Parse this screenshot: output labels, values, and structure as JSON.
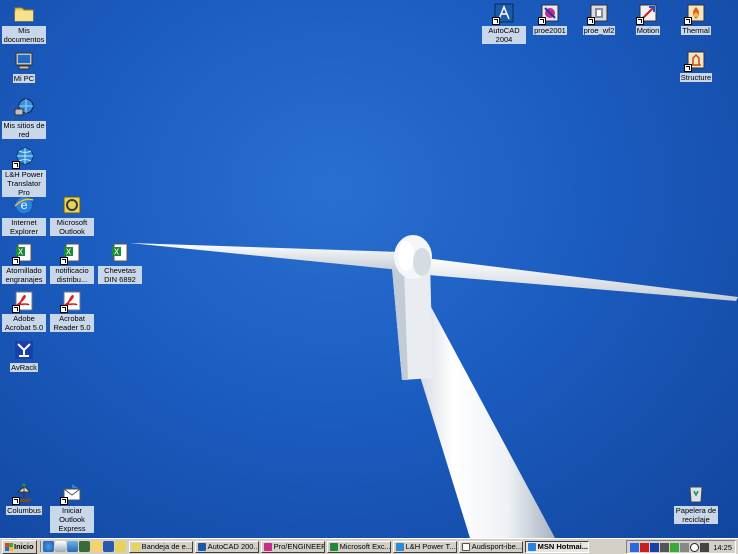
{
  "desktop": {
    "icons_left": [
      {
        "label": "Mis documentos",
        "icon": "folder-icon"
      },
      {
        "label": "Mi PC",
        "icon": "computer-icon"
      },
      {
        "label": "Mis sitios de red",
        "icon": "network-icon"
      },
      {
        "label": "L&H Power Translator Pro",
        "icon": "globe-icon"
      },
      {
        "label": "Internet Explorer",
        "icon": "internet-explorer-icon"
      },
      {
        "label": "Microsoft Outlook",
        "icon": "outlook-icon"
      },
      {
        "label": "Atornillado engranajes",
        "icon": "excel-icon"
      },
      {
        "label": "notificacio distribu...",
        "icon": "excel-icon"
      },
      {
        "label": "Chevetas DIN 6892",
        "icon": "excel-icon"
      },
      {
        "label": "Adobe Acrobat 5.0",
        "icon": "acrobat-icon"
      },
      {
        "label": "Acrobat Reader 5.0",
        "icon": "acrobat-reader-icon"
      },
      {
        "label": "AvRack",
        "icon": "avrack-icon"
      },
      {
        "label": "Columbus",
        "icon": "columbus-icon"
      },
      {
        "label": "Iniciar Outlook Express",
        "icon": "outlook-express-icon"
      }
    ],
    "icons_right": [
      {
        "label": "AutoCAD 2004",
        "icon": "autocad-icon"
      },
      {
        "label": "proe2001",
        "icon": "proe-icon"
      },
      {
        "label": "proe_wf2",
        "icon": "proe-wildfire-icon"
      },
      {
        "label": "Motion",
        "icon": "motion-icon"
      },
      {
        "label": "Thermal",
        "icon": "thermal-icon"
      },
      {
        "label": "Structure",
        "icon": "structure-icon"
      },
      {
        "label": "Papelera de reciclaje",
        "icon": "recycle-bin-icon"
      }
    ]
  },
  "taskbar": {
    "start_label": "Inicio",
    "quick_launch": [
      "internet-explorer-icon",
      "outlook-express-icon",
      "show-desktop-icon",
      "media-icon",
      "folder-icon",
      "word-icon",
      "outlook-icon"
    ],
    "tasks": [
      {
        "label": "Bandeja de e...",
        "icon": "outlook-icon",
        "active": false
      },
      {
        "label": "AutoCAD 200...",
        "icon": "autocad-icon",
        "active": false
      },
      {
        "label": "Pro/ENGINEER",
        "icon": "proe-icon",
        "active": false
      },
      {
        "label": "Microsoft Exc...",
        "icon": "excel-icon",
        "active": false
      },
      {
        "label": "L&H Power T...",
        "icon": "globe-icon",
        "active": false
      },
      {
        "label": "Audisport-ibe...",
        "icon": "document-icon",
        "active": false
      },
      {
        "label": "MSN Hotmai...",
        "icon": "internet-explorer-icon",
        "active": true
      }
    ],
    "clock": "14:25"
  },
  "colors": {
    "sky": "#1b5cc0",
    "label_bg": "#c9d7ea",
    "taskbar": "#d4d0c8"
  }
}
